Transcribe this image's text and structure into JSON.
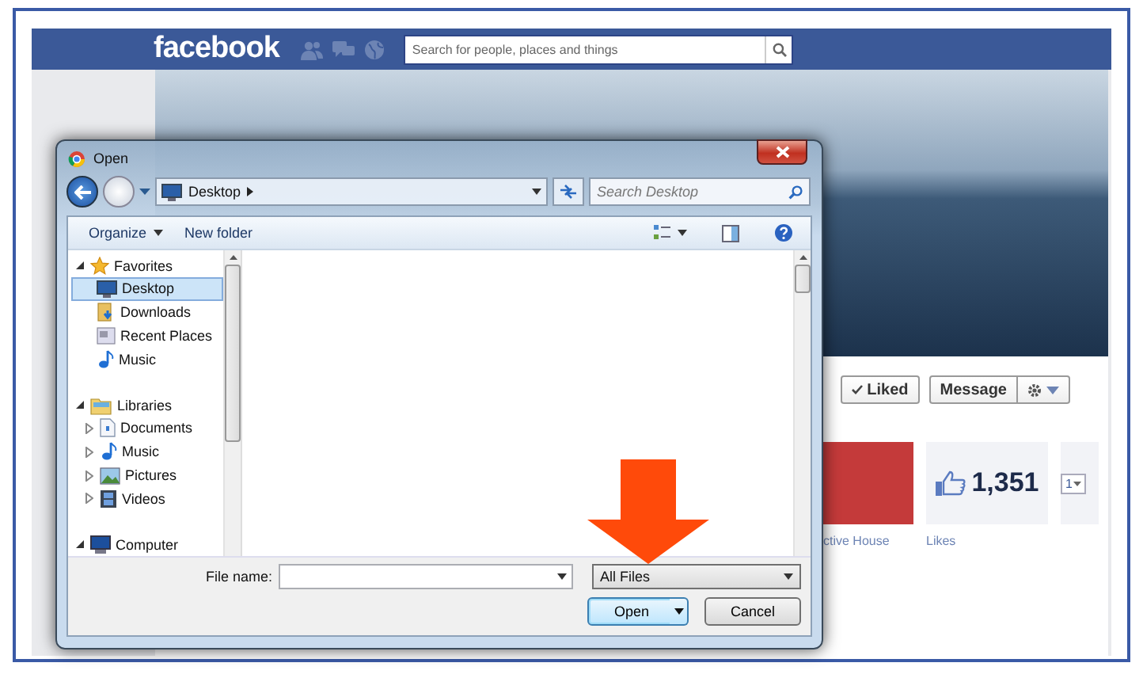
{
  "facebook_bar": {
    "logo": "facebook",
    "search": {
      "placeholder": "Search for people, places and things"
    }
  },
  "page_actions": {
    "buttons": [
      {
        "kind": "liked",
        "label": "Liked"
      },
      {
        "kind": "message",
        "label": "Message"
      },
      {
        "kind": "gear"
      }
    ]
  },
  "tiles": [
    {
      "kind": "photo",
      "caption": "ctive House"
    },
    {
      "kind": "likes",
      "count": "1,351",
      "caption": "Likes"
    },
    {
      "kind": "menu",
      "label": "1"
    }
  ],
  "dialog": {
    "title": "Open",
    "address": {
      "location": "Desktop"
    },
    "search": {
      "placeholder": "Search Desktop"
    },
    "toolbar": {
      "organize": "Organize",
      "new_folder": "New folder"
    },
    "nav_tree": [
      {
        "kind": "favorites",
        "label": "Favorites",
        "expanded": true,
        "selected": false,
        "children": [
          {
            "kind": "desktop",
            "label": "Desktop",
            "selected": true
          },
          {
            "kind": "downloads",
            "label": "Downloads",
            "selected": false
          },
          {
            "kind": "recent",
            "label": "Recent Places",
            "selected": false
          },
          {
            "kind": "music",
            "label": "Music",
            "selected": false
          }
        ]
      },
      {
        "kind": "libraries",
        "label": "Libraries",
        "expanded": true,
        "selected": false,
        "children": [
          {
            "kind": "documents",
            "label": "Documents",
            "expanded": false,
            "selected": false
          },
          {
            "kind": "music",
            "label": "Music",
            "expanded": false,
            "selected": false
          },
          {
            "kind": "pictures",
            "label": "Pictures",
            "expanded": false,
            "selected": false
          },
          {
            "kind": "videos",
            "label": "Videos",
            "expanded": false,
            "selected": false
          }
        ]
      },
      {
        "kind": "computer",
        "label": "Computer",
        "expanded": true,
        "selected": false
      }
    ],
    "file_name_label": "File name:",
    "file_type": "All Files",
    "buttons": [
      {
        "kind": "open",
        "label": "Open"
      },
      {
        "kind": "cancel",
        "label": "Cancel"
      }
    ]
  }
}
